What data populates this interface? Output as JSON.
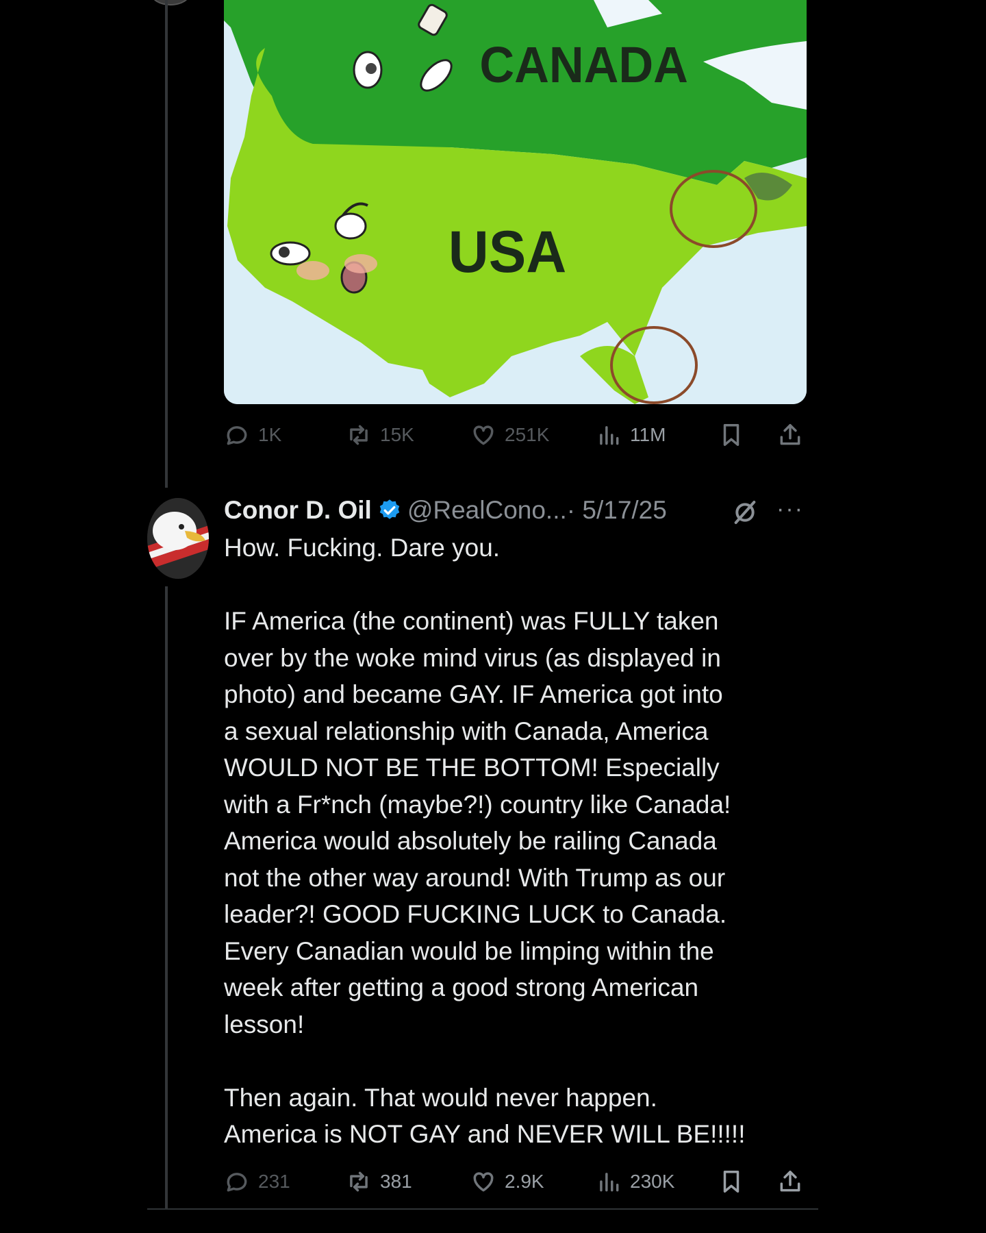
{
  "first_post": {
    "map_labels": {
      "north": "CANADA",
      "south": "USA"
    },
    "actions": {
      "replies": "1K",
      "reposts": "15K",
      "likes": "251K",
      "views": "11M"
    }
  },
  "reply_post": {
    "author_name": "Conor D. Oil",
    "handle": "@RealCono...",
    "date": "· 5/17/25",
    "more_label": "···",
    "paragraph1_lines": [
      "How. Fucking. Dare you."
    ],
    "paragraph2_lines": [
      "IF America (the continent) was FULLY taken",
      "over by the woke mind virus (as displayed in",
      "photo) and became GAY. IF America got into",
      "a sexual relationship with Canada, America",
      "WOULD NOT BE THE BOTTOM! Especially",
      "with a Fr*nch (maybe?!) country like Canada!",
      "America would absolutely be railing Canada",
      "not the other way around! With Trump as our",
      "leader?! GOOD FUCKING LUCK to Canada.",
      "Every Canadian would be limping within the",
      "week after getting a good strong American",
      "lesson!"
    ],
    "paragraph3_lines": [
      "Then again. That would never happen.",
      "America is NOT GAY and NEVER WILL BE!!!!!"
    ],
    "actions": {
      "replies": "231",
      "reposts": "381",
      "likes": "2.9K",
      "views": "230K"
    }
  },
  "icons": [
    "reply-icon",
    "repost-icon",
    "like-icon",
    "views-icon",
    "bookmark-icon",
    "share-icon",
    "verified-icon",
    "grok-icon"
  ],
  "colors": {
    "background": "#000000",
    "text": "#e7e9ea",
    "muted": "#71767b",
    "verified": "#1d9bf0",
    "canada_green": "#27a12a",
    "usa_green": "#8fd61e"
  }
}
